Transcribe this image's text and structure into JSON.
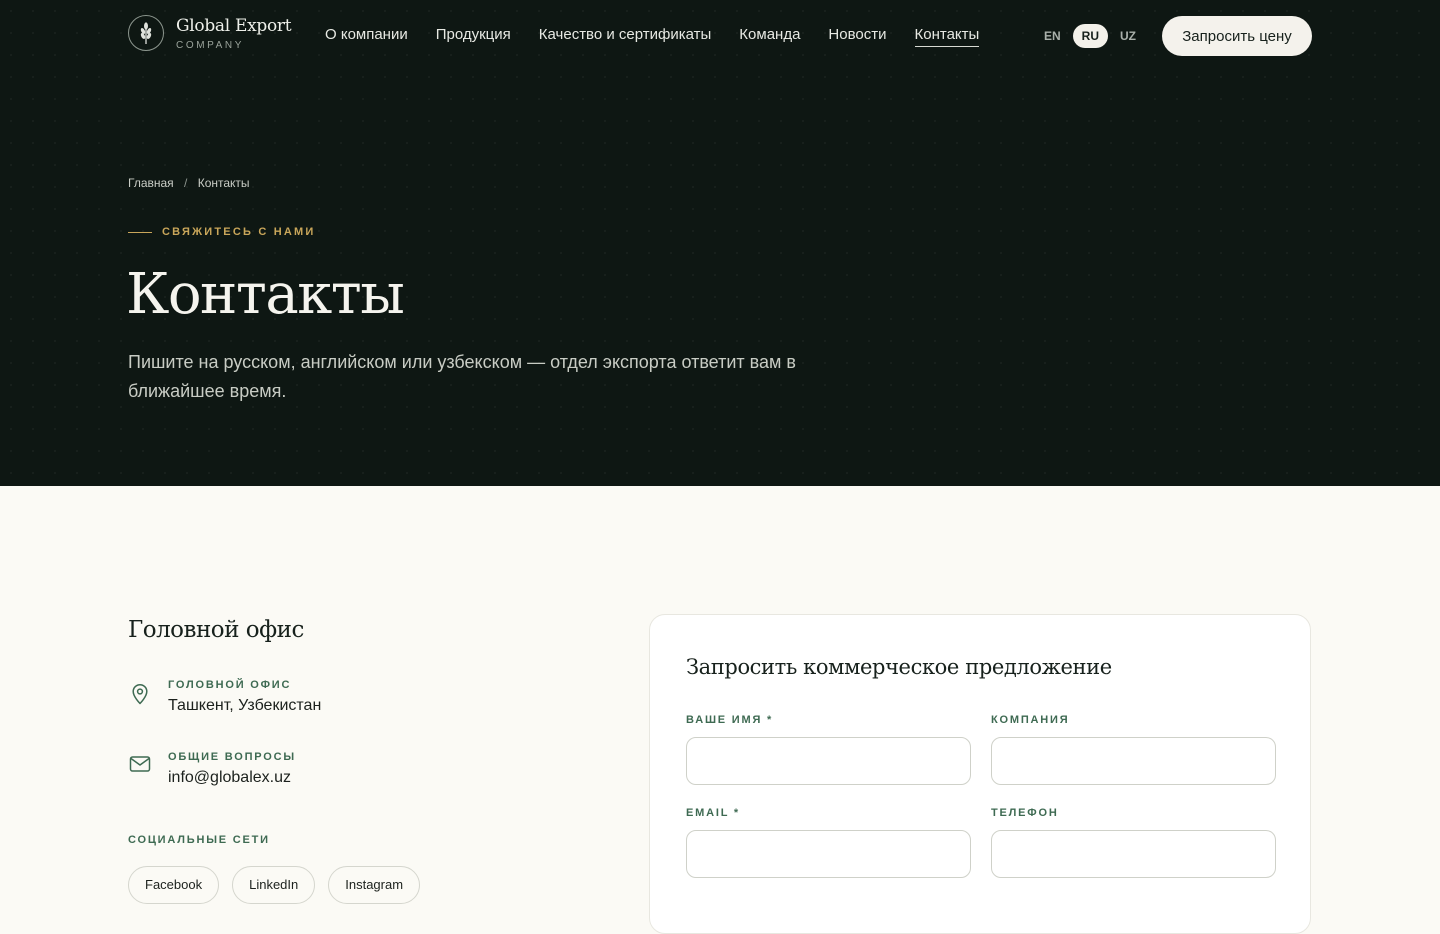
{
  "header": {
    "logo_name": "Global Export",
    "logo_sub": "COMPANY",
    "nav": [
      {
        "label": "О компании"
      },
      {
        "label": "Продукция"
      },
      {
        "label": "Качество и сертификаты"
      },
      {
        "label": "Команда"
      },
      {
        "label": "Новости"
      },
      {
        "label": "Контакты",
        "active": true
      }
    ],
    "languages": [
      {
        "label": "EN"
      },
      {
        "label": "RU",
        "active": true
      },
      {
        "label": "UZ"
      }
    ],
    "cta_label": "Запросить цену"
  },
  "hero": {
    "breadcrumb": {
      "home": "Главная",
      "separator": "/",
      "current": "Контакты"
    },
    "eyebrow": "СВЯЖИТЕСЬ С НАМИ",
    "title": "Контакты",
    "lead": "Пишите на русском, английском или узбекском — отдел экспорта ответит вам в ближайшее время."
  },
  "office": {
    "title": "Головной офис",
    "items": [
      {
        "icon": "map-pin-icon",
        "label": "ГОЛОВНОЙ ОФИС",
        "value": "Ташкент, Узбекистан"
      },
      {
        "icon": "mail-icon",
        "label": "ОБЩИЕ ВОПРОСЫ",
        "value": "info@globalex.uz"
      }
    ],
    "social_label": "СОЦИАЛЬНЫЕ СЕТИ",
    "socials": [
      "Facebook",
      "LinkedIn",
      "Instagram"
    ]
  },
  "form": {
    "title": "Запросить коммерческое предложение",
    "fields": [
      {
        "label": "ВАШЕ ИМЯ *",
        "value": ""
      },
      {
        "label": "КОМПАНИЯ",
        "value": ""
      },
      {
        "label": "EMAIL *",
        "value": ""
      },
      {
        "label": "ТЕЛЕФОН",
        "value": ""
      }
    ]
  },
  "colors": {
    "hero_bg": "#0e1713",
    "accent_gold": "#c9a65a",
    "accent_green": "#3e6a52",
    "page_bg": "#fbfaf5"
  }
}
